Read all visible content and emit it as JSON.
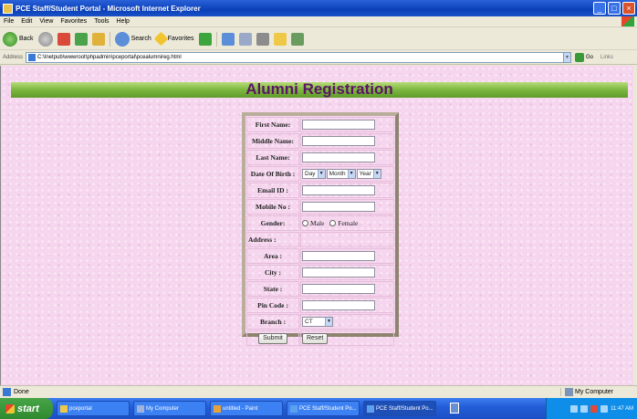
{
  "window": {
    "title": "PCE Staff/Student Portal - Microsoft Internet Explorer"
  },
  "menu": [
    "File",
    "Edit",
    "View",
    "Favorites",
    "Tools",
    "Help"
  ],
  "toolbar": {
    "back": "Back",
    "search": "Search",
    "favorites": "Favorites"
  },
  "address": {
    "label": "Address",
    "url": "C:\\Inetpub\\wwwroot\\phpadmin\\pceportal\\pcealumnireg.html",
    "go": "Go",
    "links": "Links"
  },
  "page": {
    "title": "Alumni Registration"
  },
  "form": {
    "first_name": "First Name:",
    "middle_name": "Middle Name:",
    "last_name": "Last Name:",
    "dob": "Date Of Birth :",
    "dob_day": "Day",
    "dob_month": "Month",
    "dob_year": "Year",
    "email": "Email ID :",
    "mobile": "Mobile No :",
    "gender": "Gender:",
    "male": "Male",
    "female": "Female",
    "address": "Address :",
    "area": "Area :",
    "city": "City :",
    "state": "State :",
    "pincode": "Pin Code :",
    "branch": "Branch :",
    "branch_value": "CT",
    "submit": "Submit",
    "reset": "Reset"
  },
  "status": {
    "left": "Done",
    "zone": "My Computer"
  },
  "taskbar": {
    "start": "start",
    "tasks": [
      "pceportal",
      "My Computer",
      "untitled - Paint",
      "PCE Staff/Student Po...",
      "PCE Staff/Student Po..."
    ],
    "clock": "11:47 AM"
  }
}
